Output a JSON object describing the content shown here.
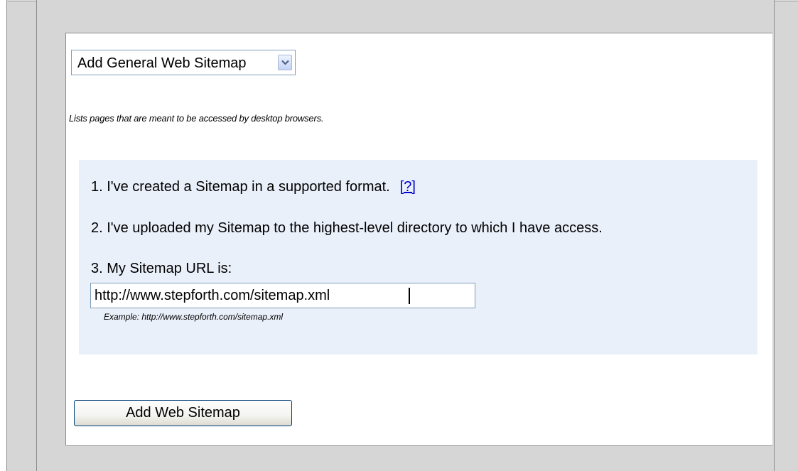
{
  "sitemap_type_select": {
    "selected": "Add General Web Sitemap"
  },
  "description": "Lists pages that are meant to be accessed by desktop browsers.",
  "steps": [
    {
      "text": "1. I've created a Sitemap in a supported format."
    },
    {
      "text": "2. I've uploaded my Sitemap to the highest-level directory to which I have access."
    },
    {
      "text": "3. My Sitemap URL is:"
    }
  ],
  "help_link": "[?]",
  "url_input": {
    "value": "http://www.stepforth.com/sitemap.xml"
  },
  "example_text": "Example: http://www.stepforth.com/sitemap.xml",
  "submit_button": "Add Web Sitemap",
  "colors": {
    "background": "#d6d6d6",
    "panel": "#ffffff",
    "steps_box": "#eaf0fa",
    "link": "#0000cc",
    "input_border": "#7f9db9"
  },
  "icons": {
    "select_arrow": "chevron-down-icon"
  }
}
